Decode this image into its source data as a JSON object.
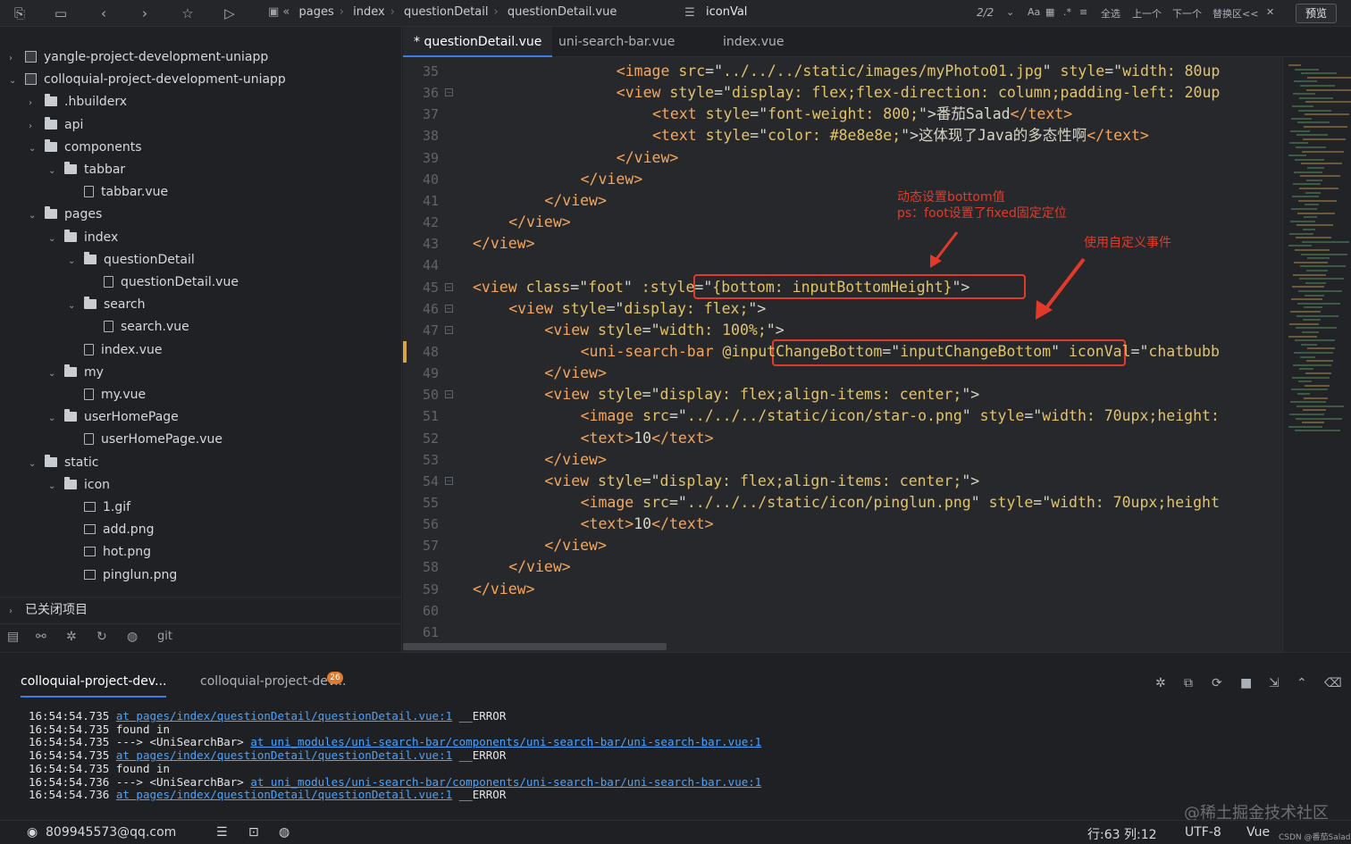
{
  "toolbar": {
    "breadcrumb": [
      "pages",
      "index",
      "questionDetail",
      "questionDetail.vue"
    ],
    "find_text": "iconVal",
    "match_count": "2/2",
    "find_controls": [
      "Aa",
      "全选",
      "上一个",
      "下一个",
      "替换区<<"
    ],
    "preview_label": "预览"
  },
  "sidebar": {
    "tree": [
      {
        "label": "yangle-project-development-uniapp",
        "kind": "project",
        "depth": 0,
        "chevron": "right"
      },
      {
        "label": "colloquial-project-development-uniapp",
        "kind": "project",
        "depth": 0,
        "chevron": "down"
      },
      {
        "label": ".hbuilderx",
        "kind": "folder",
        "depth": 1,
        "chevron": "right"
      },
      {
        "label": "api",
        "kind": "folder",
        "depth": 1,
        "chevron": "right"
      },
      {
        "label": "components",
        "kind": "folder",
        "depth": 1,
        "chevron": "down"
      },
      {
        "label": "tabbar",
        "kind": "folder",
        "depth": 2,
        "chevron": "down"
      },
      {
        "label": "tabbar.vue",
        "kind": "file",
        "depth": 3,
        "chevron": ""
      },
      {
        "label": "pages",
        "kind": "folder",
        "depth": 1,
        "chevron": "down"
      },
      {
        "label": "index",
        "kind": "folder",
        "depth": 2,
        "chevron": "down"
      },
      {
        "label": "questionDetail",
        "kind": "folder",
        "depth": 3,
        "chevron": "down"
      },
      {
        "label": "questionDetail.vue",
        "kind": "file",
        "depth": 4,
        "chevron": ""
      },
      {
        "label": "search",
        "kind": "folder",
        "depth": 3,
        "chevron": "down"
      },
      {
        "label": "search.vue",
        "kind": "file",
        "depth": 4,
        "chevron": ""
      },
      {
        "label": "index.vue",
        "kind": "file",
        "depth": 3,
        "chevron": ""
      },
      {
        "label": "my",
        "kind": "folder",
        "depth": 2,
        "chevron": "down"
      },
      {
        "label": "my.vue",
        "kind": "file",
        "depth": 3,
        "chevron": ""
      },
      {
        "label": "userHomePage",
        "kind": "folder",
        "depth": 2,
        "chevron": "down"
      },
      {
        "label": "userHomePage.vue",
        "kind": "file",
        "depth": 3,
        "chevron": ""
      },
      {
        "label": "static",
        "kind": "folder",
        "depth": 1,
        "chevron": "down"
      },
      {
        "label": "icon",
        "kind": "folder",
        "depth": 2,
        "chevron": "down"
      },
      {
        "label": "1.gif",
        "kind": "image",
        "depth": 3,
        "chevron": ""
      },
      {
        "label": "add.png",
        "kind": "image",
        "depth": 3,
        "chevron": ""
      },
      {
        "label": "hot.png",
        "kind": "image",
        "depth": 3,
        "chevron": ""
      },
      {
        "label": "pinglun.png",
        "kind": "image",
        "depth": 3,
        "chevron": ""
      }
    ],
    "closed_projects": "已关闭项目",
    "git_label": "git"
  },
  "editor": {
    "tabs": [
      "* questionDetail.vue",
      "uni-search-bar.vue",
      "index.vue"
    ],
    "lines": [
      {
        "n": "35",
        "fold": false,
        "indent": 16,
        "parts": [
          [
            "t",
            "<image "
          ],
          [
            "a",
            "src"
          ],
          [
            "p",
            "=\""
          ],
          [
            "s",
            "../../../static/images/myPhoto01.jpg"
          ],
          [
            "p",
            "\" "
          ],
          [
            "a",
            "style"
          ],
          [
            "p",
            "=\""
          ],
          [
            "s",
            "width: 80up"
          ]
        ]
      },
      {
        "n": "36",
        "fold": true,
        "indent": 16,
        "parts": [
          [
            "t",
            "<view "
          ],
          [
            "a",
            "style"
          ],
          [
            "p",
            "=\""
          ],
          [
            "s",
            "display: flex;flex-direction: column;padding-left: 20up"
          ]
        ]
      },
      {
        "n": "37",
        "fold": false,
        "indent": 20,
        "parts": [
          [
            "t",
            "<text "
          ],
          [
            "a",
            "style"
          ],
          [
            "p",
            "=\""
          ],
          [
            "s",
            "font-weight: 800;"
          ],
          [
            "p",
            "\">番茄Salad"
          ],
          [
            "t",
            "</text>"
          ]
        ]
      },
      {
        "n": "38",
        "fold": false,
        "indent": 20,
        "parts": [
          [
            "t",
            "<text "
          ],
          [
            "a",
            "style"
          ],
          [
            "p",
            "=\""
          ],
          [
            "s",
            "color: #8e8e8e;"
          ],
          [
            "p",
            "\">这体现了Java的多态性啊"
          ],
          [
            "t",
            "</text>"
          ]
        ]
      },
      {
        "n": "39",
        "fold": false,
        "indent": 16,
        "parts": [
          [
            "t",
            "</view>"
          ]
        ]
      },
      {
        "n": "40",
        "fold": false,
        "indent": 12,
        "parts": [
          [
            "t",
            "</view>"
          ]
        ]
      },
      {
        "n": "41",
        "fold": false,
        "indent": 8,
        "parts": [
          [
            "t",
            "</view>"
          ]
        ]
      },
      {
        "n": "42",
        "fold": false,
        "indent": 4,
        "parts": [
          [
            "t",
            "</view>"
          ]
        ]
      },
      {
        "n": "43",
        "fold": false,
        "indent": 0,
        "parts": [
          [
            "t",
            "</view>"
          ]
        ]
      },
      {
        "n": "44",
        "fold": false,
        "indent": 0,
        "parts": []
      },
      {
        "n": "45",
        "fold": true,
        "indent": 0,
        "parts": [
          [
            "t",
            "<view "
          ],
          [
            "a",
            "class"
          ],
          [
            "p",
            "=\""
          ],
          [
            "s",
            "foot"
          ],
          [
            "p",
            "\" "
          ],
          [
            "a",
            ":style"
          ],
          [
            "p",
            "=\""
          ],
          [
            "s",
            "{bottom: inputBottomHeight}"
          ],
          [
            "p",
            "\">"
          ]
        ]
      },
      {
        "n": "46",
        "fold": true,
        "indent": 4,
        "parts": [
          [
            "t",
            "<view "
          ],
          [
            "a",
            "style"
          ],
          [
            "p",
            "=\""
          ],
          [
            "s",
            "display: flex;"
          ],
          [
            "p",
            "\">"
          ]
        ]
      },
      {
        "n": "47",
        "fold": true,
        "indent": 8,
        "parts": [
          [
            "t",
            "<view "
          ],
          [
            "a",
            "style"
          ],
          [
            "p",
            "=\""
          ],
          [
            "s",
            "width: 100%;"
          ],
          [
            "p",
            "\">"
          ]
        ]
      },
      {
        "n": "48",
        "fold": false,
        "indent": 12,
        "parts": [
          [
            "t",
            "<uni-search-bar "
          ],
          [
            "a",
            "@inputChangeBottom"
          ],
          [
            "p",
            "=\""
          ],
          [
            "s",
            "inputChangeBottom"
          ],
          [
            "p",
            "\" "
          ],
          [
            "a",
            "iconVal"
          ],
          [
            "p",
            "=\""
          ],
          [
            "s",
            "chatbubb"
          ]
        ]
      },
      {
        "n": "49",
        "fold": false,
        "indent": 8,
        "parts": [
          [
            "t",
            "</view>"
          ]
        ]
      },
      {
        "n": "50",
        "fold": true,
        "indent": 8,
        "parts": [
          [
            "t",
            "<view "
          ],
          [
            "a",
            "style"
          ],
          [
            "p",
            "=\""
          ],
          [
            "s",
            "display: flex;align-items: center;"
          ],
          [
            "p",
            "\">"
          ]
        ]
      },
      {
        "n": "51",
        "fold": false,
        "indent": 12,
        "parts": [
          [
            "t",
            "<image "
          ],
          [
            "a",
            "src"
          ],
          [
            "p",
            "=\""
          ],
          [
            "s",
            "../../../static/icon/star-o.png"
          ],
          [
            "p",
            "\" "
          ],
          [
            "a",
            "style"
          ],
          [
            "p",
            "=\""
          ],
          [
            "s",
            "width: 70upx;height:"
          ]
        ]
      },
      {
        "n": "52",
        "fold": false,
        "indent": 12,
        "parts": [
          [
            "t",
            "<text>"
          ],
          [
            "p",
            "10"
          ],
          [
            "t",
            "</text>"
          ]
        ]
      },
      {
        "n": "53",
        "fold": false,
        "indent": 8,
        "parts": [
          [
            "t",
            "</view>"
          ]
        ]
      },
      {
        "n": "54",
        "fold": true,
        "indent": 8,
        "parts": [
          [
            "t",
            "<view "
          ],
          [
            "a",
            "style"
          ],
          [
            "p",
            "=\""
          ],
          [
            "s",
            "display: flex;align-items: center;"
          ],
          [
            "p",
            "\">"
          ]
        ]
      },
      {
        "n": "55",
        "fold": false,
        "indent": 12,
        "parts": [
          [
            "t",
            "<image "
          ],
          [
            "a",
            "src"
          ],
          [
            "p",
            "=\""
          ],
          [
            "s",
            "../../../static/icon/pinglun.png"
          ],
          [
            "p",
            "\" "
          ],
          [
            "a",
            "style"
          ],
          [
            "p",
            "=\""
          ],
          [
            "s",
            "width: 70upx;height"
          ]
        ]
      },
      {
        "n": "56",
        "fold": false,
        "indent": 12,
        "parts": [
          [
            "t",
            "<text>"
          ],
          [
            "p",
            "10"
          ],
          [
            "t",
            "</text>"
          ]
        ]
      },
      {
        "n": "57",
        "fold": false,
        "indent": 8,
        "parts": [
          [
            "t",
            "</view>"
          ]
        ]
      },
      {
        "n": "58",
        "fold": false,
        "indent": 4,
        "parts": [
          [
            "t",
            "</view>"
          ]
        ]
      },
      {
        "n": "59",
        "fold": false,
        "indent": 0,
        "parts": [
          [
            "t",
            "</view>"
          ]
        ]
      },
      {
        "n": "60",
        "fold": false,
        "indent": 0,
        "parts": []
      },
      {
        "n": "61",
        "fold": false,
        "indent": 0,
        "parts": []
      }
    ],
    "annotations": {
      "note1_line1": "动态设置bottom值",
      "note1_line2": "ps：foot设置了fixed固定定位",
      "note2": "使用自定义事件"
    }
  },
  "console": {
    "tabs": [
      "colloquial-project-dev...",
      "colloquial-project-dev..."
    ],
    "badge": "26",
    "log": [
      {
        "time": "16:54:54.735",
        "prefix": "",
        "link": "at pages/index/questionDetail/questionDetail.vue:1",
        "suffix": " __ERROR"
      },
      {
        "time": "16:54:54.735",
        "prefix": "found in",
        "link": "",
        "suffix": ""
      },
      {
        "time": "16:54:54.735",
        "prefix": "---> <UniSearchBar> ",
        "link": "at uni_modules/uni-search-bar/components/uni-search-bar/uni-search-bar.vue:1",
        "suffix": ""
      },
      {
        "time": "16:54:54.735",
        "prefix": "",
        "link": "at pages/index/questionDetail/questionDetail.vue:1",
        "suffix": " __ERROR"
      },
      {
        "time": "16:54:54.735",
        "prefix": "found in",
        "link": "",
        "suffix": ""
      },
      {
        "time": "16:54:54.736",
        "prefix": "---> <UniSearchBar> ",
        "link": "at uni_modules/uni-search-bar/components/uni-search-bar/uni-search-bar.vue:1",
        "suffix": ""
      },
      {
        "time": "16:54:54.736",
        "prefix": "",
        "link": "at pages/index/questionDetail/questionDetail.vue:1",
        "suffix": " __ERROR"
      }
    ]
  },
  "status": {
    "account": "809945573@qq.com",
    "position": "行:63  列:12",
    "encoding": "UTF-8",
    "language": "Vue",
    "corner_text": "CSDN @番茄Salad"
  },
  "watermark": "@稀土掘金技术社区",
  "colors": {
    "accent": "#3c7ee8",
    "annotation_red": "#e23a2a",
    "tag": "#f5a65b",
    "string": "#e0c46c"
  }
}
